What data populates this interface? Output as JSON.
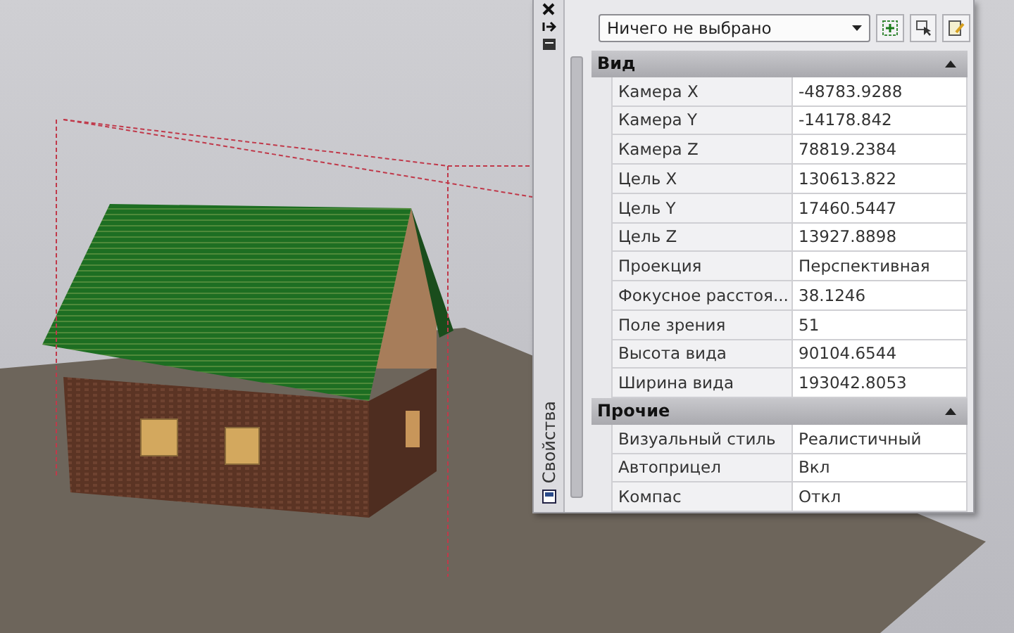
{
  "panel": {
    "title": "Свойства",
    "selector": {
      "value": "Ничего не выбрано"
    },
    "sections": [
      {
        "title": "Вид",
        "expanded": true,
        "rows": [
          {
            "name": "Камера X",
            "value": "-48783.9288"
          },
          {
            "name": "Камера Y",
            "value": "-14178.842"
          },
          {
            "name": "Камера Z",
            "value": "78819.2384"
          },
          {
            "name": "Цель X",
            "value": "130613.822"
          },
          {
            "name": "Цель Y",
            "value": "17460.5447"
          },
          {
            "name": "Цель Z",
            "value": "13927.8898"
          },
          {
            "name": "Проекция",
            "value": "Перспективная"
          },
          {
            "name": "Фокусное расстоя...",
            "value": "38.1246"
          },
          {
            "name": "Поле зрения",
            "value": "51"
          },
          {
            "name": "Высота вида",
            "value": "90104.6544"
          },
          {
            "name": "Ширина вида",
            "value": "193042.8053"
          }
        ]
      },
      {
        "title": "Прочие",
        "expanded": true,
        "rows": [
          {
            "name": "Визуальный стиль",
            "value": "Реалистичный"
          },
          {
            "name": "Автоприцел",
            "value": "Вкл"
          },
          {
            "name": "Компас",
            "value": "Откл"
          }
        ]
      }
    ]
  }
}
